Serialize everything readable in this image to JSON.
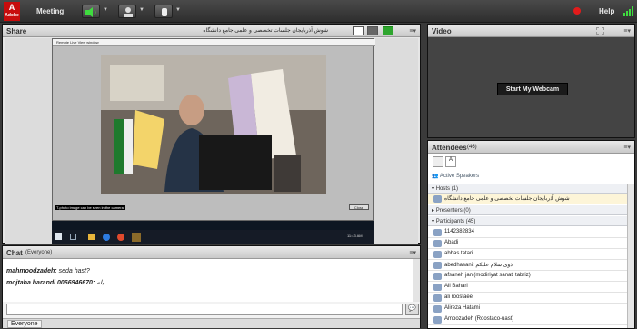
{
  "topbar": {
    "logo": "Adobe",
    "meeting": "Meeting",
    "help": "Help"
  },
  "share": {
    "title": "Share",
    "presenter_name": "شوش آذربایجان جلسات تخصصی و علمی جامع دانشگاه",
    "video_window_title": "Remote Live View window",
    "overlay_caption": "T-photo image can be seen in the camera",
    "close_label": "Close",
    "clock": "11:43 AM"
  },
  "chat": {
    "title": "Chat",
    "scope": "(Everyone)",
    "messages": [
      {
        "author": "mahmoodzadeh:",
        "text": "seda hast?"
      },
      {
        "author": "mojtaba  harandi  0066946670:",
        "text": "بله"
      }
    ],
    "recipient": "Everyone"
  },
  "video": {
    "title": "Video",
    "webcam_button": "Start My Webcam"
  },
  "attendees": {
    "title": "Attendees",
    "count": "(46)",
    "active_speakers": "Active Speakers",
    "hosts_label": "Hosts (1)",
    "host_name": "شوش آذربایجان جلسات تخصصی و علمی جامع دانشگاه",
    "presenters_label": "Presenters (0)",
    "participants_label": "Participants (45)",
    "participants": [
      "1142382834",
      "Abadi",
      "abbas tatari",
      "abedhasani: ذوی سلام علیکم",
      "afsaneh jani(modiriyat sanati tabriz)",
      "Ali Bahari",
      "ali roostaee",
      "Alireza Hatami",
      "Amoozadeh (Roostaco-uast)"
    ]
  },
  "colors": {
    "accent": "#2a6fb0",
    "record": "#e21b1b"
  }
}
